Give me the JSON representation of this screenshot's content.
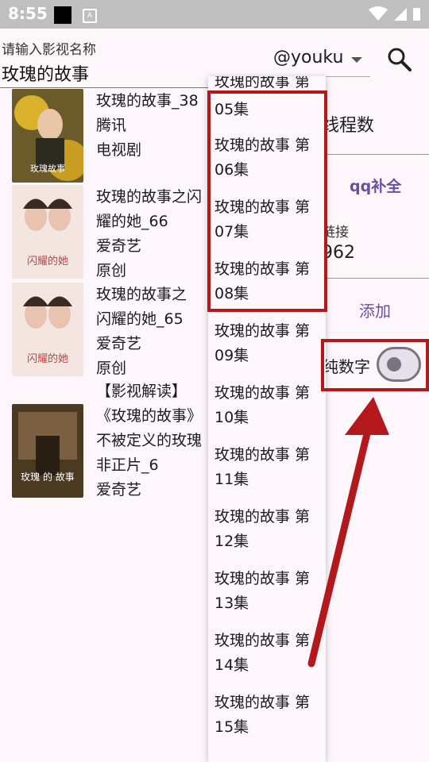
{
  "status_bar": {
    "time": "8:55"
  },
  "search": {
    "hint": "请输入影视名称",
    "value": "玫瑰的故事"
  },
  "source": {
    "selected": "@youku"
  },
  "results": [
    {
      "lines": [
        "玫瑰的故事_38",
        "腾讯",
        "电视剧"
      ],
      "thumb_text": "玫瑰故事"
    },
    {
      "lines": [
        "玫瑰的故事之闪",
        "耀的她_66",
        "爱奇艺",
        "原创"
      ],
      "thumb_text": "闪耀的她"
    },
    {
      "lines": [
        "玫瑰的故事之",
        "闪耀的她_65",
        "爱奇艺",
        "原创"
      ],
      "thumb_text": "闪耀的她"
    },
    {
      "lines": [
        "【影视解读】",
        "《玫瑰的故事》",
        "不被定义的玫瑰",
        "非正片_6",
        "爱奇艺"
      ],
      "thumb_text": "玫瑰 的 故事"
    }
  ],
  "dropdown": {
    "items": [
      [
        "",
        "05集"
      ],
      [
        "玫瑰的故事 第",
        "06集"
      ],
      [
        "玫瑰的故事 第",
        "07集"
      ],
      [
        "玫瑰的故事 第",
        "08集"
      ],
      [
        "玫瑰的故事 第",
        "09集"
      ],
      [
        "玫瑰的故事 第",
        "10集"
      ],
      [
        "玫瑰的故事 第",
        "11集"
      ],
      [
        "玫瑰的故事 第",
        "12集"
      ],
      [
        "玫瑰的故事 第",
        "13集"
      ],
      [
        "玫瑰的故事 第",
        "14集"
      ],
      [
        "玫瑰的故事 第",
        "15集"
      ]
    ]
  },
  "panel": {
    "threads_label": "线程数",
    "qq_button": "qq补全",
    "link_label": "链接",
    "link_value": "962",
    "add_button": "添加",
    "pure_number_label": "纯数字",
    "pure_number_on": false
  },
  "colors": {
    "accent": "#6750a4",
    "annotation": "#b3181d",
    "background": "#fdf7fc"
  }
}
